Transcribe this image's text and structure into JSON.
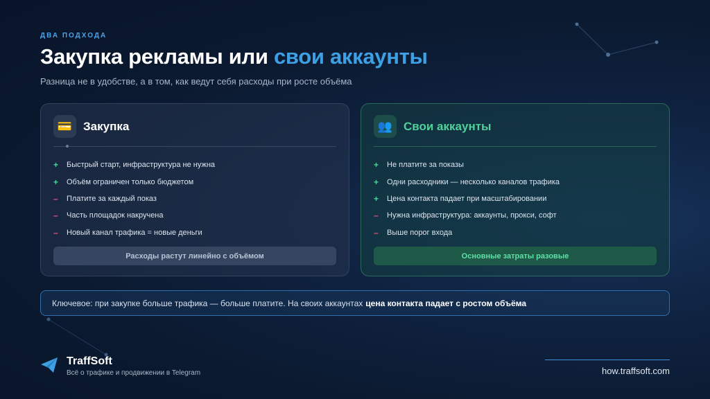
{
  "eyebrow": "ДВА ПОДХОДА",
  "title": {
    "main": "Закупка рекламы или",
    "accent": "свои аккаунты"
  },
  "subtitle": "Разница не в удобстве, а в том, как ведут себя расходы при росте объёма",
  "cards": [
    {
      "icon": "credit-card-icon",
      "icon_glyph": "💳",
      "title": "Закупка",
      "items": [
        {
          "sign": "+",
          "text": "Быстрый старт, инфраструктура не нужна"
        },
        {
          "sign": "+",
          "text": "Объём ограничен только бюджетом"
        },
        {
          "sign": "–",
          "text": "Платите за каждый показ"
        },
        {
          "sign": "–",
          "text": "Часть площадок накручена"
        },
        {
          "sign": "–",
          "text": "Новый канал трафика = новые деньги"
        }
      ],
      "footer": "Расходы растут линейно с объёмом"
    },
    {
      "icon": "users-icon",
      "icon_glyph": "👥",
      "title": "Свои аккаунты",
      "items": [
        {
          "sign": "+",
          "text": "Не платите за показы"
        },
        {
          "sign": "+",
          "text": "Одни расходники — несколько каналов трафика"
        },
        {
          "sign": "+",
          "text": "Цена контакта падает при масштабировании"
        },
        {
          "sign": "–",
          "text": "Нужна инфраструктура: аккаунты, прокси, софт"
        },
        {
          "sign": "–",
          "text": "Выше порог входа"
        }
      ],
      "footer": "Основные затраты разовые"
    }
  ],
  "key": {
    "text": "Ключевое: при закупке больше трафика — больше платите. На своих аккаунтах",
    "bold": "цена контакта падает с ростом объёма"
  },
  "brand": {
    "icon": "telegram-plane-icon",
    "name": "TraffSoft",
    "tagline": "Всё о трафике и продвижении в Telegram"
  },
  "url": "how.traffsoft.com",
  "colors": {
    "accent_blue": "#3ea0e4",
    "plus_green": "#4fd199",
    "minus_red": "#e2557a",
    "background": "#0b1a30"
  }
}
